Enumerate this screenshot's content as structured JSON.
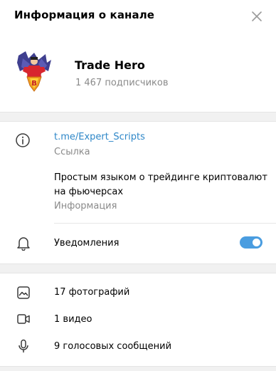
{
  "header": {
    "title": "Информация о канале",
    "close_icon": "close-icon"
  },
  "channel": {
    "name": "Trade Hero",
    "subscribers": "1 467 подписчиков",
    "avatar": "superhero-bitcoin-logo"
  },
  "info": {
    "link": "t.me/Expert_Scripts",
    "link_caption": "Ссылка",
    "description": "Простым языком о трейдинге криптовалют на фьючерсах",
    "description_caption": "Информация"
  },
  "notifications": {
    "label": "Уведомления",
    "enabled": true,
    "accent": "#4a9de0"
  },
  "media": [
    {
      "icon": "photo-icon",
      "label": "17 фотографий"
    },
    {
      "icon": "video-icon",
      "label": "1 видео"
    },
    {
      "icon": "microphone-icon",
      "label": "9 голосовых сообщений"
    }
  ],
  "colors": {
    "link": "#2e87c8",
    "caption": "#8a8a8a",
    "toggle": "#4a9de0"
  }
}
